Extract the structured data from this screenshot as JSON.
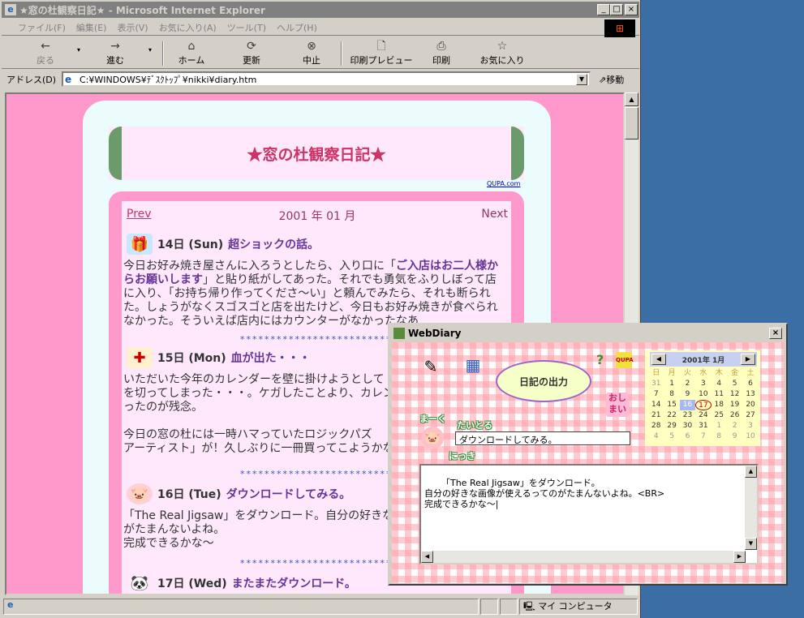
{
  "window": {
    "title": "★窓の杜観察日記★ - Microsoft Internet Explorer",
    "controls": [
      "_",
      "□",
      "×"
    ]
  },
  "menu": [
    "ファイル(F)",
    "編集(E)",
    "表示(V)",
    "お気に入り(A)",
    "ツール(T)",
    "ヘルプ(H)"
  ],
  "toolbar": {
    "back": "戻る",
    "forward": "進む",
    "home": "ホーム",
    "refresh": "更新",
    "stop": "中止",
    "print_preview": "印刷プレビュー",
    "print": "印刷",
    "favorites": "お気に入り"
  },
  "address": {
    "label": "アドレス(D)",
    "value": "C:¥WINDOWS¥ﾃﾞｽｸﾄｯﾌﾟ¥nikki¥diary.htm",
    "go": "移動"
  },
  "page": {
    "title": "★窓の杜観察日記★",
    "credit": "QUPA.com",
    "nav": {
      "prev": "Prev",
      "month": "2001 年 01 月",
      "next": "Next"
    },
    "separator": "***************************",
    "entries": [
      {
        "date": "14日 (Sun)",
        "subject": "超ショックの話。",
        "body_1": "今日お好み焼き屋さんに入ろうとしたら、入り口に「",
        "body_bold": "ご入店はお二人様からお願いします",
        "body_2": "」と貼り紙がしてあった。それでも勇気をふりしぼって店に入り、「お持ち帰り作ってくださ～い」と頼んでみたら、それも断られた。しょうがなくスゴスゴと店を出たけど、今日もお好み焼きが食べられなかった。そういえば店内にはカウンターがなかったなあ"
      },
      {
        "date": "15日 (Mon)",
        "subject": "血が出た・・・",
        "body": "いただいた今年のカレンダーを壁に掛けようとして\nを切ってしまった・・・。ケガしたことより、カレンダー\nったのが残念。\n\n今日の窓の杜には一時ハマっていたロジックパズ\nアーティスト」が！久しぶりに一冊買ってこようかな"
      },
      {
        "date": "16日 (Tue)",
        "subject": "ダウンロードしてみる。",
        "body": "「The Real Jigsaw」をダウンロード。自分の好きな\nがたまんないよね。\n完成できるかな～"
      },
      {
        "date": "17日 (Wed)",
        "subject": "またまたダウンロード。"
      }
    ]
  },
  "status": {
    "zone": "マイ コンピュータ"
  },
  "webdiary": {
    "title": "WebDiary",
    "output_bubble": "日記の出力",
    "close_button": "おし\nまい",
    "calendar": {
      "title": "2001年 1月",
      "weekdays": [
        "日",
        "月",
        "火",
        "水",
        "木",
        "金",
        "土"
      ],
      "rows": [
        [
          "31",
          "1",
          "2",
          "3",
          "4",
          "5",
          "6"
        ],
        [
          "7",
          "8",
          "9",
          "10",
          "11",
          "12",
          "13"
        ],
        [
          "14",
          "15",
          "16",
          "17",
          "18",
          "19",
          "20"
        ],
        [
          "21",
          "22",
          "23",
          "24",
          "25",
          "26",
          "27"
        ],
        [
          "28",
          "29",
          "30",
          "31",
          "1",
          "2",
          "3"
        ],
        [
          "4",
          "5",
          "6",
          "7",
          "8",
          "9",
          "10"
        ]
      ],
      "selected": "16",
      "today": "17"
    },
    "label_name": "まーく",
    "label_title": "たいとる",
    "label_diary": "にっき",
    "subject_value": "ダウンロードしてみる。",
    "diary_text": "「The Real Jigsaw」をダウンロード。\n自分の好きな画像が使えるってのがたまんないよね。<BR>\n完成できるかな～|"
  }
}
